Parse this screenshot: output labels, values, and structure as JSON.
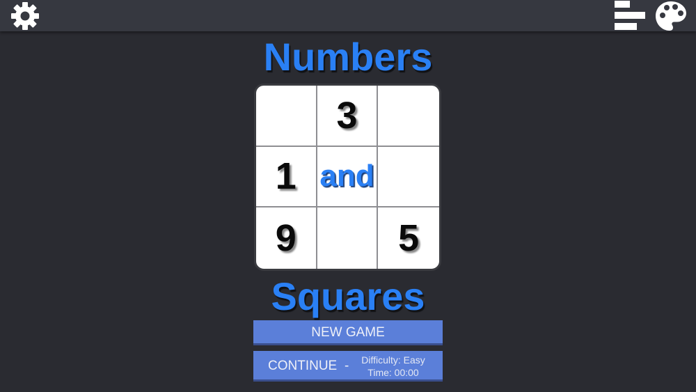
{
  "header": {
    "settings_icon": "gear-icon",
    "stats_icon": "bar-chart-icon",
    "theme_icon": "palette-icon"
  },
  "title": {
    "top": "Numbers",
    "bottom": "Squares"
  },
  "board": {
    "cells": [
      "",
      "3",
      "",
      "1",
      "and",
      "",
      "9",
      "",
      "5"
    ]
  },
  "menu": {
    "new_game_label": "NEW GAME",
    "continue_label": "CONTINUE",
    "continue_separator": "-",
    "difficulty": "Difficulty: Easy",
    "time": "Time: 00:00"
  },
  "colors": {
    "accent": "#2a80f5",
    "button": "#5b7fd9",
    "background": "#2a2b31",
    "topbar": "#363840"
  }
}
